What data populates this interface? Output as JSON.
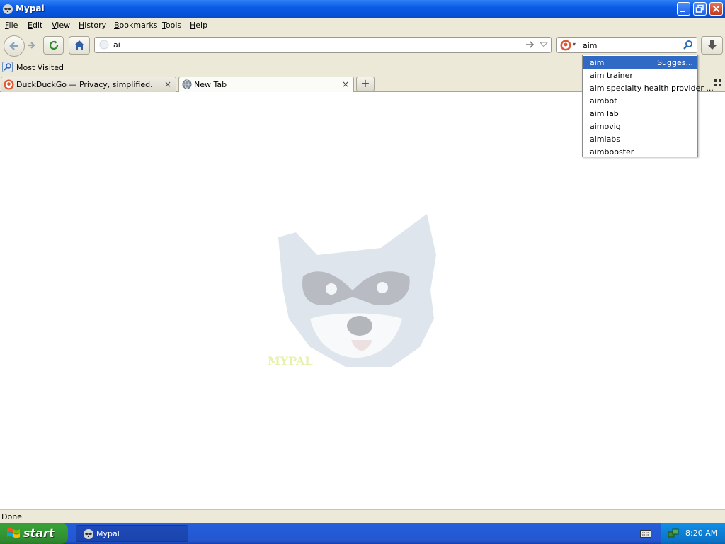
{
  "window": {
    "title": "Mypal",
    "app_icon": "raccoon-icon"
  },
  "menu": {
    "items": [
      {
        "label": "File",
        "mnemonic": "F",
        "rest": "ile"
      },
      {
        "label": "Edit",
        "mnemonic": "E",
        "rest": "dit"
      },
      {
        "label": "View",
        "mnemonic": "V",
        "rest": "iew"
      },
      {
        "label": "History",
        "mnemonic": "H",
        "rest": "istory"
      },
      {
        "label": "Bookmarks",
        "mnemonic": "B",
        "rest": "ookmarks"
      },
      {
        "label": "Tools",
        "mnemonic": "T",
        "rest": "ools"
      },
      {
        "label": "Help",
        "mnemonic": "H",
        "rest": "elp"
      }
    ]
  },
  "navigation": {
    "back_icon": "back-arrow-icon",
    "forward_icon": "forward-arrow-icon",
    "reload_icon": "reload-icon",
    "home_icon": "home-icon",
    "download_icon": "download-arrow-icon"
  },
  "urlbar": {
    "value": "ai",
    "go_icon": "go-arrow-icon",
    "dropdown_icon": "dropdown-triangle-icon"
  },
  "searchbar": {
    "value": "aim",
    "engine_icon": "duckduckgo-icon",
    "search_icon": "magnifier-icon"
  },
  "bookmarks": {
    "items": [
      {
        "label": "Most Visited",
        "icon": "most-visited-icon"
      }
    ]
  },
  "tabs": [
    {
      "label": "DuckDuckGo — Privacy, simplified.",
      "icon": "duckduckgo-icon",
      "active": false,
      "close": "×"
    },
    {
      "label": "New Tab",
      "icon": "globe-icon",
      "active": true,
      "close": "×"
    }
  ],
  "new_tab_button": "+",
  "suggestions": {
    "items": [
      "aim",
      "aim trainer",
      "aim specialty health provider ...",
      "aimbot",
      "aim lab",
      "aimovig",
      "aimlabs",
      "aimbooster"
    ],
    "selected_hint": "Sugges..."
  },
  "content": {
    "watermark_logo": "MYPAL"
  },
  "status": {
    "text": "Done"
  },
  "taskbar": {
    "start_label": "start",
    "task_label": "Mypal",
    "clock": "8:20 AM"
  },
  "colors": {
    "titlebar_blue": "#0a5ce6",
    "selection_blue": "#316ac5",
    "chrome_beige": "#ece9d8",
    "start_green": "#37a037"
  }
}
